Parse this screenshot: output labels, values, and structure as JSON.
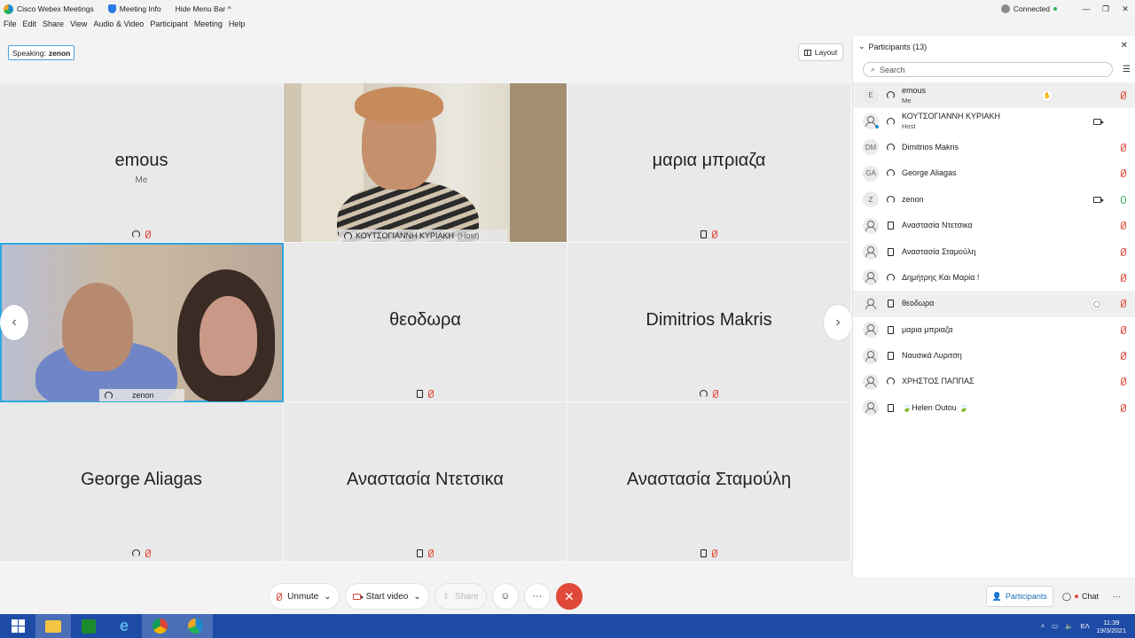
{
  "window": {
    "app_title": "Cisco Webex Meetings",
    "meeting_info": "Meeting Info",
    "hide_menu": "Hide Menu Bar ^",
    "connection": "Connected",
    "minimize": "—",
    "maximize": "❐",
    "close": "✕"
  },
  "menu": [
    "File",
    "Edit",
    "Share",
    "View",
    "Audio & Video",
    "Participant",
    "Meeting",
    "Help"
  ],
  "speaking": {
    "label": "Speaking:",
    "name": "zenon"
  },
  "layout_button": "Layout",
  "tiles": [
    {
      "name": "emous",
      "sub": "Me"
    },
    {
      "name": "ΚΟΥΤΣΟΓΙΑΝΝΗ ΚΥΡΙΑΚΗ",
      "sub": "(Host)"
    },
    {
      "name": "μαρια μπριαζα"
    },
    {
      "name": "zenon"
    },
    {
      "name": "θεοδωρα"
    },
    {
      "name": "Dimitrios Makris"
    },
    {
      "name": "George Aliagas"
    },
    {
      "name": "Αναστασία Ντετσικα"
    },
    {
      "name": "Αναστασία Σταμούλη"
    }
  ],
  "toolbar": {
    "unmute": "Unmute",
    "start_video": "Start video",
    "share": "Share"
  },
  "participants": {
    "title": "Participants (13)",
    "search_placeholder": "Search",
    "list": [
      {
        "initials": "E",
        "name": "emous",
        "role": "Me"
      },
      {
        "initials": "",
        "name": "ΚΟΥΤΣΟΓΙΑΝΝΗ ΚΥΡΙΑΚΗ",
        "role": "Host"
      },
      {
        "initials": "DM",
        "name": "Dimitrios Makris"
      },
      {
        "initials": "GA",
        "name": "George Aliagas"
      },
      {
        "initials": "Z",
        "name": "zenon"
      },
      {
        "initials": "",
        "name": "Αναστασία Ντετσικα"
      },
      {
        "initials": "",
        "name": "Αναστασία Σταμούλη"
      },
      {
        "initials": "",
        "name": "Δημήτρης Και Μαρία !"
      },
      {
        "initials": "",
        "name": "θεοδωρα"
      },
      {
        "initials": "",
        "name": "μαρια μπριαζα"
      },
      {
        "initials": "",
        "name": "Ναυσικά Λυριτση"
      },
      {
        "initials": "",
        "name": "ΧΡΗΣΤΟΣ ΠΑΠΠΑΣ"
      },
      {
        "initials": "",
        "name": "🍃Helen Outou 🍃"
      }
    ]
  },
  "panel_bar": {
    "participants": "Participants",
    "chat": "Chat",
    "more": "···"
  },
  "taskbar": {
    "lang": "ΕΛ",
    "time": "11:39",
    "date": "19/3/2021"
  }
}
